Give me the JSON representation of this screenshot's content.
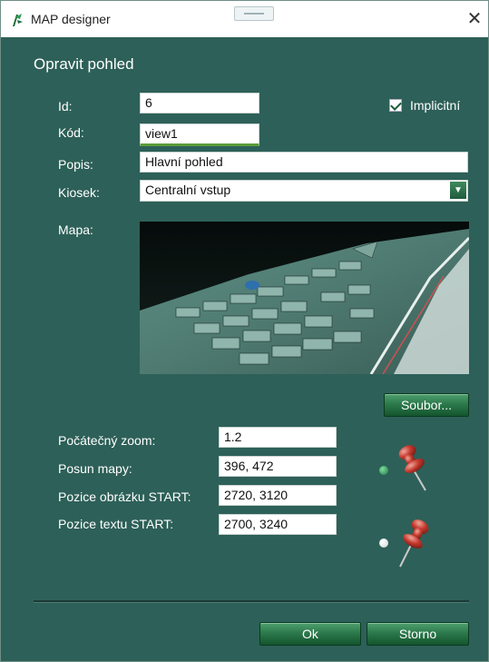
{
  "window": {
    "title": "MAP designer",
    "close_icon": "close-icon",
    "app_icon": "map-designer-app-icon"
  },
  "form": {
    "heading": "Opravit pohled",
    "id_label": "Id:",
    "id_value": "6",
    "code_label": "Kód:",
    "code_value": "view1",
    "desc_label": "Popis:",
    "desc_value": "Hlavní pohled",
    "kiosk_label": "Kiosek:",
    "kiosk_value": "Centralní vstup",
    "implicit_label": "Implicitní",
    "implicit_checked": true,
    "map_label": "Mapa:",
    "file_button": "Soubor...",
    "zoom_label": "Počátečný zoom:",
    "zoom_value": "1.2",
    "pan_label": "Posun mapy:",
    "pan_value": "396, 472",
    "image_pos_label": "Pozice obrázku START:",
    "image_pos_value": "2720, 3120",
    "text_pos_label": "Pozice textu START:",
    "text_pos_value": "2700, 3240"
  },
  "buttons": {
    "ok": "Ok",
    "cancel": "Storno"
  },
  "colors": {
    "dialog_bg": "#2d6058",
    "button_green": "#2c7a4c",
    "pin_red": "#c43a2e"
  }
}
